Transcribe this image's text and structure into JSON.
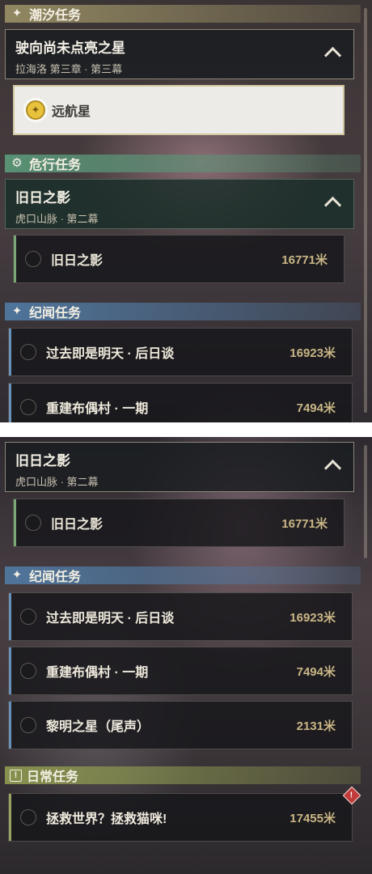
{
  "top": {
    "tide": {
      "header": "潮汐任务",
      "group_title": "驶向尚未点亮之星",
      "group_sub": "拉海洛 第三章 · 第三幕",
      "active_item": "远航星"
    },
    "risk": {
      "header": "危行任务",
      "group_title": "旧日之影",
      "group_sub": "虎口山脉 · 第二幕",
      "item_label": "旧日之影",
      "item_dist": "16771米"
    },
    "chron": {
      "header": "纪闻任务",
      "items": [
        {
          "label": "过去即是明天 · 后日谈",
          "dist": "16923米"
        },
        {
          "label": "重建布偶村 · 一期",
          "dist": "7494米"
        }
      ]
    }
  },
  "bottom": {
    "risk": {
      "group_title": "旧日之影",
      "group_sub": "虎口山脉 · 第二幕",
      "item_label": "旧日之影",
      "item_dist": "16771米"
    },
    "chron": {
      "header": "纪闻任务",
      "items": [
        {
          "label": "过去即是明天 · 后日谈",
          "dist": "16923米"
        },
        {
          "label": "重建布偶村 · 一期",
          "dist": "7494米"
        },
        {
          "label": "黎明之星（尾声）",
          "dist": "2131米"
        }
      ]
    },
    "daily": {
      "header": "日常任务",
      "items": [
        {
          "label": "拯救世界？拯救猫咪!",
          "dist": "17455米"
        }
      ]
    }
  },
  "icons": {
    "tide_icon": "sparkle-icon",
    "risk_icon": "gear-icon",
    "chron_icon": "sparkle-icon",
    "daily_icon": "exclamation-box-icon",
    "active_icon": "compass-star-icon",
    "alert_icon": "alert-diamond-icon",
    "chevron": "chevron-up-icon"
  },
  "colors": {
    "tide_header": "#968c64",
    "risk_header": "#5a9678",
    "chron_header": "#5078a0",
    "daily_header": "#8c9650",
    "distance_text": "#c9b685"
  }
}
